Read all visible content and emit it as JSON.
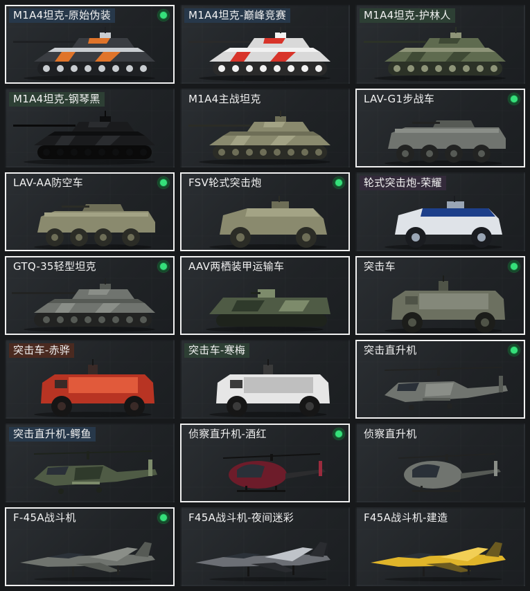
{
  "cards": [
    {
      "label": "M1A4坦克-原始伪装",
      "selected": true,
      "owned": true,
      "type": "tank",
      "camo": "orange"
    },
    {
      "label": "M1A4坦克-巅峰竞赛",
      "selected": false,
      "owned": false,
      "type": "tank",
      "camo": "race"
    },
    {
      "label": "M1A4坦克-护林人",
      "selected": false,
      "owned": false,
      "type": "tank",
      "camo": "forest"
    },
    {
      "label": "M1A4坦克-钢琴黑",
      "selected": false,
      "owned": false,
      "type": "tank",
      "camo": "black"
    },
    {
      "label": "M1A4主战坦克",
      "selected": false,
      "owned": false,
      "type": "tank",
      "camo": "tan"
    },
    {
      "label": "LAV-G1步战车",
      "selected": true,
      "owned": true,
      "type": "ifv",
      "camo": "grey"
    },
    {
      "label": "LAV-AA防空车",
      "selected": true,
      "owned": true,
      "type": "ifv",
      "camo": "tan"
    },
    {
      "label": "FSV轮式突击炮",
      "selected": true,
      "owned": true,
      "type": "armored_car",
      "camo": "tan"
    },
    {
      "label": "轮式突击炮-荣耀",
      "selected": false,
      "owned": false,
      "type": "armored_car",
      "camo": "bluewhite"
    },
    {
      "label": "GTQ-35轻型坦克",
      "selected": true,
      "owned": true,
      "type": "light_tank",
      "camo": "grey"
    },
    {
      "label": "AAV两栖装甲运输车",
      "selected": true,
      "owned": false,
      "type": "amphibious",
      "camo": "green"
    },
    {
      "label": "突击车",
      "selected": true,
      "owned": true,
      "type": "mrap",
      "camo": "olive"
    },
    {
      "label": "突击车-赤骅",
      "selected": false,
      "owned": false,
      "type": "mrap",
      "camo": "red"
    },
    {
      "label": "突击车-寒梅",
      "selected": false,
      "owned": false,
      "type": "mrap",
      "camo": "white"
    },
    {
      "label": "突击直升机",
      "selected": true,
      "owned": true,
      "type": "attack_heli",
      "camo": "grey"
    },
    {
      "label": "突击直升机-鳄鱼",
      "selected": false,
      "owned": false,
      "type": "attack_heli",
      "camo": "green"
    },
    {
      "label": "侦察直升机-酒红",
      "selected": true,
      "owned": true,
      "type": "scout_heli",
      "camo": "wine"
    },
    {
      "label": "侦察直升机",
      "selected": false,
      "owned": false,
      "type": "scout_heli",
      "camo": "grey"
    },
    {
      "label": "F-45A战斗机",
      "selected": true,
      "owned": true,
      "type": "jet",
      "camo": "grey"
    },
    {
      "label": "F45A战斗机-夜间迷彩",
      "selected": false,
      "owned": false,
      "type": "jet",
      "camo": "night"
    },
    {
      "label": "F45A战斗机-建造",
      "selected": false,
      "owned": false,
      "type": "jet",
      "camo": "yellow"
    }
  ],
  "icons": {
    "owned_indicator": "green-dot-icon"
  },
  "colors": {
    "owned": "#35e07a",
    "selected_border": "#f1f1f1",
    "background": "#17191b"
  }
}
